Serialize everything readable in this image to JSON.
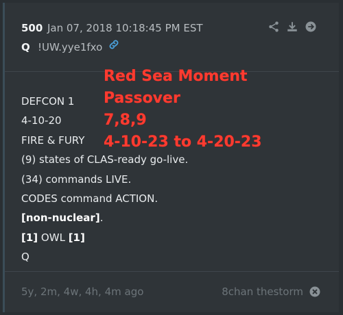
{
  "post": {
    "number": "500",
    "date": "Jan 07, 2018 10:18:45 PM EST",
    "author": "Q",
    "tripcode": "!UW.yye1fxo",
    "lines": [
      "DEFCON 1",
      "4-10-20",
      "FIRE & FURY",
      "(9) states of CLAS-ready go-live.",
      "(34) commands LIVE.",
      "CODES command ACTION."
    ],
    "nonnuclear": "[non-nuclear]",
    "period": ".",
    "bracket_one_a": "[1]",
    "owl": " OWL ",
    "bracket_one_b": "[1]",
    "signoff": "Q"
  },
  "annotation": {
    "lines": [
      "Red Sea Moment",
      "Passover",
      "7,8,9",
      "4-10-23 to 4-20-23"
    ],
    "color": "#ff3b30"
  },
  "footer": {
    "ago": "5y, 2m, 4w, 4h, 4m ago",
    "source": "8chan thestorm"
  },
  "icons": [
    "share-icon",
    "download-icon",
    "arrow-right-circle-icon",
    "link-icon",
    "close-circle-icon"
  ]
}
